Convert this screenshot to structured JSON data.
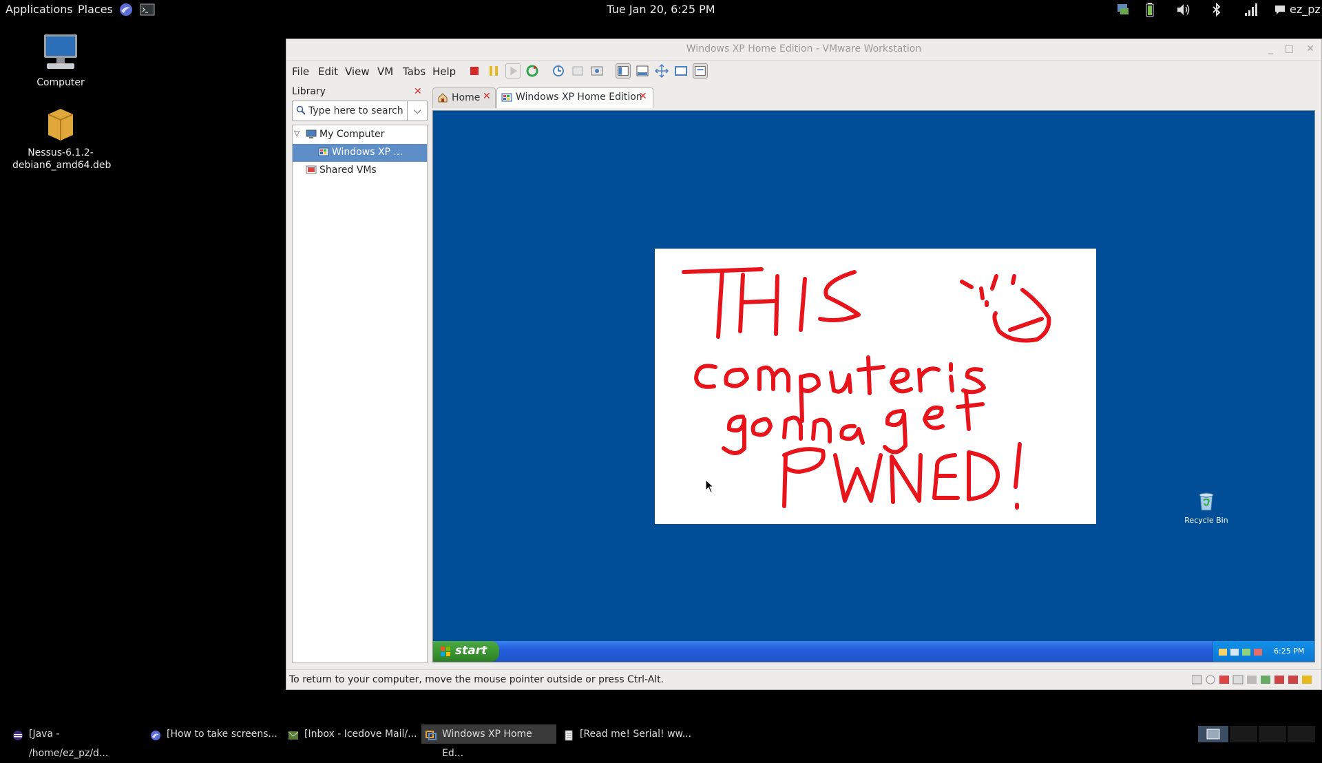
{
  "topbar": {
    "applications": "Applications",
    "places": "Places",
    "clock": "Tue Jan 20,  6:25 PM",
    "user": "ez_pz",
    "icons": [
      "browser-icon",
      "terminal-icon",
      "display-icon",
      "battery-icon",
      "volume-icon",
      "bluetooth-icon",
      "network-icon",
      "chat-icon"
    ]
  },
  "desktop": {
    "icons": [
      {
        "label": "Computer",
        "icon": "computer-icon"
      },
      {
        "label_line1": "Nessus-6.1.2-",
        "label_line2": "debian6_amd64.deb",
        "icon": "package-icon"
      }
    ]
  },
  "vmware": {
    "title": "Windows XP Home Edition - VMware Workstation",
    "menu": [
      "File",
      "Edit",
      "View",
      "VM",
      "Tabs",
      "Help"
    ],
    "library": {
      "header": "Library",
      "search_placeholder": "Type here to search",
      "tree": [
        {
          "label": "My Computer",
          "level": 0
        },
        {
          "label": "Windows XP ...",
          "level": 1,
          "selected": true
        },
        {
          "label": "Shared VMs",
          "level": 0
        }
      ]
    },
    "tabs": [
      {
        "label": "Home",
        "active": false
      },
      {
        "label": "Windows XP Home Edition",
        "active": true
      }
    ],
    "guest": {
      "message": "THIS computer is gonna get PWNED!",
      "recycle_bin": "Recycle Bin",
      "start": "start",
      "tray_time": "6:25 PM"
    },
    "status": "To return to your computer, move the mouse pointer outside or press Ctrl-Alt."
  },
  "taskbar": {
    "items": [
      {
        "label": "[Java - /home/ez_pz/d...",
        "active": false
      },
      {
        "label": "[How to take screens...",
        "active": false
      },
      {
        "label": "[Inbox - Icedove Mail/...",
        "active": false
      },
      {
        "label": "Windows XP Home Ed...",
        "active": true
      },
      {
        "label": "[Read me! Serial! ww...",
        "active": false
      }
    ]
  },
  "colors": {
    "xp_desktop": "#004e98",
    "selection": "#5d8ec8",
    "paint_ink": "#e8141c"
  }
}
